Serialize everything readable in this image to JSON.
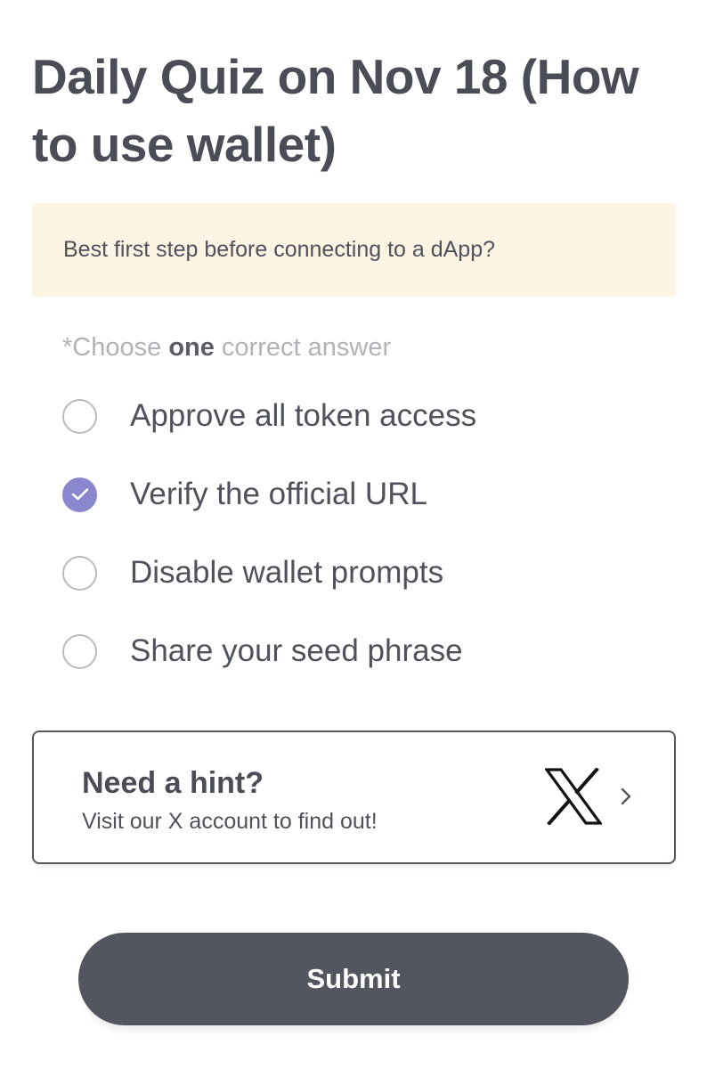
{
  "page": {
    "title": "Daily Quiz on Nov 18 (How to use wallet)"
  },
  "question": {
    "text": "Best first step before connecting to a dApp?"
  },
  "instruction": {
    "prefix": "*Choose ",
    "emphasis": "one",
    "suffix": " correct answer"
  },
  "options": [
    {
      "label": "Approve all token access",
      "selected": false
    },
    {
      "label": "Verify the official URL",
      "selected": true
    },
    {
      "label": "Disable wallet prompts",
      "selected": false
    },
    {
      "label": "Share your seed phrase",
      "selected": false
    }
  ],
  "hint": {
    "title": "Need a hint?",
    "subtitle": "Visit our X account to find out!",
    "icon": "x-logo-icon"
  },
  "submit": {
    "label": "Submit"
  },
  "colors": {
    "accent": "#8b87cf",
    "question_bg": "#fdf4e3",
    "button": "#53565f"
  }
}
